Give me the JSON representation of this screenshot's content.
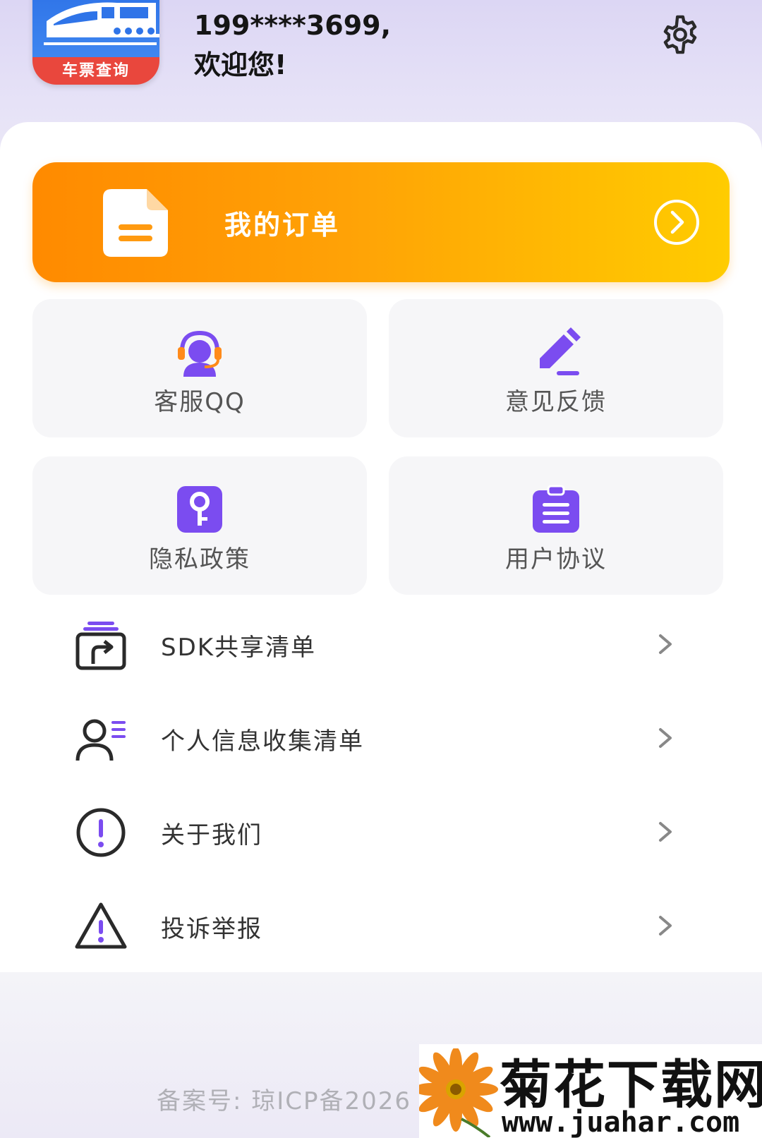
{
  "header": {
    "logo_text": "车票查询",
    "phone": "199****3699,",
    "welcome": "欢迎您!",
    "settings_icon": "gear-icon"
  },
  "order": {
    "label": "我的订单",
    "icon": "document-icon",
    "arrow_icon": "chevron-right-circle-icon"
  },
  "tiles": [
    {
      "label": "客服QQ",
      "icon": "headset-icon"
    },
    {
      "label": "意见反馈",
      "icon": "pen-icon"
    },
    {
      "label": "隐私政策",
      "icon": "key-icon"
    },
    {
      "label": "用户协议",
      "icon": "clipboard-icon"
    }
  ],
  "list": [
    {
      "label": "SDK共享清单",
      "icon": "share-stack-icon"
    },
    {
      "label": "个人信息收集清单",
      "icon": "user-list-icon"
    },
    {
      "label": "关于我们",
      "icon": "info-circle-icon"
    },
    {
      "label": "投诉举报",
      "icon": "warning-triangle-icon"
    }
  ],
  "footer": {
    "beian": "备案号: 琼ICP备2026"
  },
  "watermark": {
    "title": "菊花下载网",
    "url": "www.juahar.com"
  },
  "colors": {
    "accent_purple": "#7b4cf0",
    "order_gradient_start": "#ff8a00",
    "order_gradient_end": "#ffcc00"
  }
}
